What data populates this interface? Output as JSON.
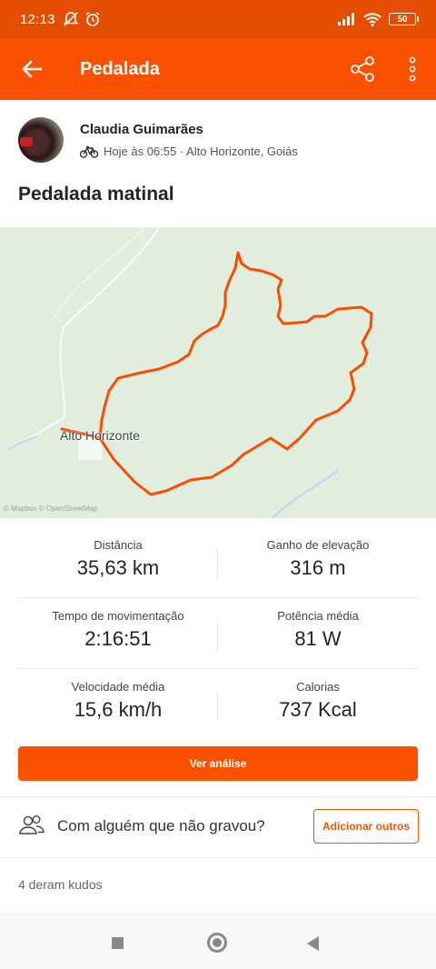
{
  "status_bar": {
    "time": "12:13",
    "battery": "50",
    "icons": [
      "mute-icon",
      "alarm-icon",
      "signal-icon",
      "wifi-icon",
      "battery-icon"
    ]
  },
  "app_bar": {
    "title": "Pedalada",
    "icons": [
      "back-arrow-icon",
      "share-icon",
      "more-vertical-icon"
    ]
  },
  "athlete": {
    "name": "Claudia Guimarães",
    "meta": "Hoje às 06:55 · Alto Horizonte, Goiás",
    "sport_icon": "bike-icon"
  },
  "activity": {
    "title": "Pedalada matinal"
  },
  "map": {
    "town_label": "Alto Horizonte",
    "attribution": "© Mapbox © OpenStreetMap",
    "route_color": "#fc4c02",
    "background_color": "#e2eedd"
  },
  "stats": [
    {
      "label": "Distância",
      "value": "35,63 km"
    },
    {
      "label": "Ganho de elevação",
      "value": "316 m"
    },
    {
      "label": "Tempo de movimentação",
      "value": "2:16:51"
    },
    {
      "label": "Potência média",
      "value": "81 W"
    },
    {
      "label": "Velocidade média",
      "value": "15,6 km/h"
    },
    {
      "label": "Calorias",
      "value": "737 Kcal"
    }
  ],
  "buttons": {
    "analysis": "Ver análise",
    "add_others": "Adicionar outros"
  },
  "invite": {
    "question": "Com alguém que não gravou?",
    "icon": "people-icon"
  },
  "kudos": {
    "text": "4 deram kudos"
  },
  "colors": {
    "brand": "#fc5200",
    "status_bar": "#e54e00"
  }
}
